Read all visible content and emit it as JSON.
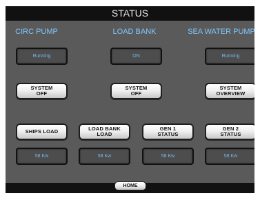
{
  "header": {
    "title": "STATUS"
  },
  "columns": {
    "circ_pump": "CIRC PUMP",
    "load_bank": "LOAD BANK",
    "sea_water_pump": "SEA WATER PUMP"
  },
  "status_readouts": {
    "circ_pump": "Running",
    "load_bank": "ON",
    "sea_water_pump": "Running"
  },
  "system_buttons": {
    "circ_pump": "SYSTEM\nOFF",
    "load_bank": "SYSTEM\nOFF",
    "sea_water_pump": "SYSTEM\nOVERVIEW"
  },
  "load_buttons": {
    "ships_load": "SHIPS LOAD",
    "load_bank_load": "LOAD BANK\nLOAD",
    "gen1_status": "GEN 1\nSTATUS",
    "gen2_status": "GEN 2\nSTATUS"
  },
  "load_readouts": {
    "ships_load": "58 Kw",
    "load_bank_load": "58 Kw",
    "gen1_status": "58 Kw",
    "gen2_status": "58 Kw"
  },
  "footer": {
    "home_label": "HOME"
  },
  "colors": {
    "panel_bg": "#5a5a5a",
    "bar_bg": "#111111",
    "heading_text": "#7ec8ff",
    "readout_text": "#78b8e8"
  }
}
